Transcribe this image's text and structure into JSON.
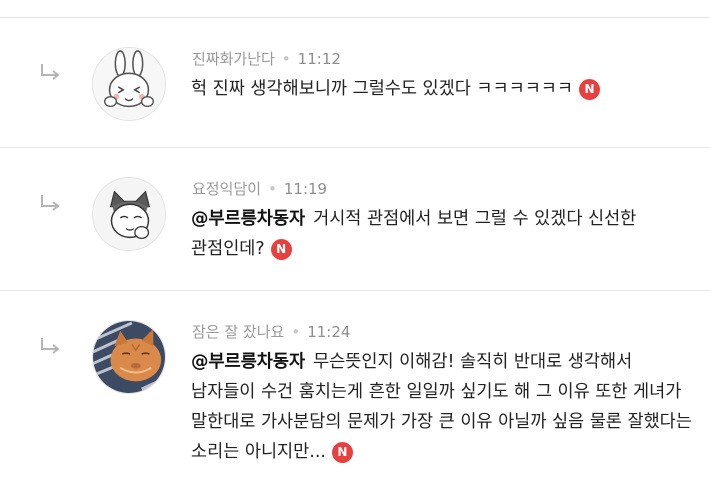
{
  "comments": [
    {
      "author": "진짜화가난다",
      "time": "11:12",
      "mention": "",
      "text": "헉 진짜 생각해보니까 그럴수도 있겠다 ㅋㅋㅋㅋㅋㅋ",
      "new_badge": "N",
      "avatar_icon": "rabbit-avatar-icon"
    },
    {
      "author": "요정익담이",
      "time": "11:19",
      "mention": "@부르릉차동자",
      "text": "거시적 관점에서 보면 그럴 수 있겠다 신선한 관점인데?",
      "new_badge": "N",
      "avatar_icon": "cat-sketch-avatar-icon"
    },
    {
      "author": "잠은 잘 잤나요",
      "time": "11:24",
      "mention": "@부르릉차동자",
      "text": "무슨뜻인지 이해감! 솔직히 반대로 생각해서 남자들이 수건 훔치는게 흔한 일일까 싶기도 해 그 이유 또한 게녀가 말한대로 가사분담의 문제가 가장 큰 이유 아닐까 싶음 물론 잘했다는 소리는 아니지만...",
      "new_badge": "N",
      "avatar_icon": "orange-cat-photo-avatar-icon"
    }
  ],
  "colors": {
    "badge": "#e83f3f",
    "meta": "#9a9a9a",
    "divider": "#e6e6e6"
  }
}
